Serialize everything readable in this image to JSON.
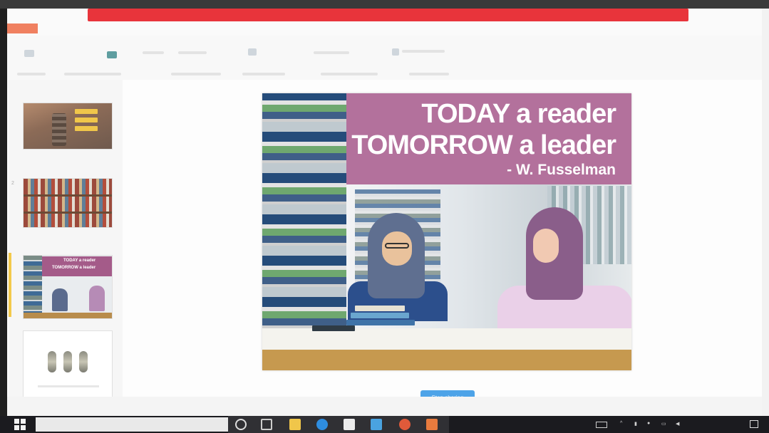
{
  "brand": {
    "label": ""
  },
  "share_bar": {
    "text": ""
  },
  "sidebar": {
    "header": {
      "left": "",
      "right": ""
    },
    "thumbs": [
      {
        "num": "",
        "label": ""
      },
      {
        "num": "2",
        "label": ""
      },
      {
        "num": "",
        "label": ""
      },
      {
        "num": "",
        "label": ""
      }
    ],
    "slide3": {
      "line1": "TODAY a reader",
      "line2": "TOMORROW a leader"
    }
  },
  "slide": {
    "line1": "TODAY a reader",
    "line2": "TOMORROW a leader",
    "line3": "- W. Fusselman",
    "caption": ""
  },
  "notes_info": "",
  "stop_button": {
    "label": "Stop sharing"
  },
  "statusbar": {
    "left": "",
    "mid": "",
    "right": ""
  },
  "taskbar": {
    "search_placeholder": "",
    "time": "",
    "date": ""
  },
  "colors": {
    "share_bar": "#e8343b",
    "header_band": "#b06a98",
    "stop_button": "#4da3e8",
    "taskbar": "#1b1b1f"
  }
}
